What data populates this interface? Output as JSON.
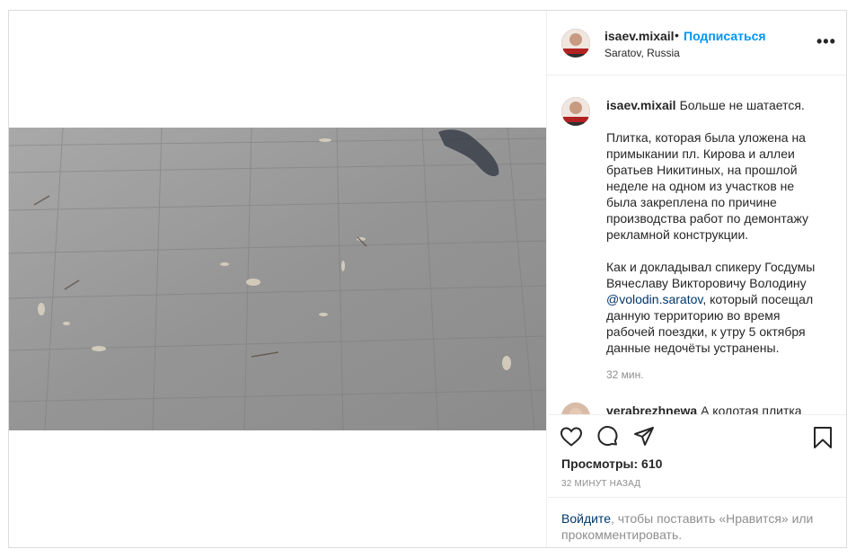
{
  "post": {
    "author": {
      "username": "isaev.mixail",
      "location": "Saratov, Russia",
      "follow_label": "Подписаться",
      "separator": "•",
      "more_label": "•••"
    },
    "caption": {
      "username": "isaev.mixail",
      "text_1": "Больше не шатается.\n\nПлитка, которая была уложена на примыкании пл. Кирова и аллеи братьев Никитиных, на прошлой неделе на одном из участков не была закреплена по причине производства работ по демонтажу рекламной конструкции.\n\nКак и докладывал спикеру Госдумы Вячеславу Викторовичу Володину ",
      "mention": "@volodin.saratov",
      "text_2": ", который посещал данную территорию во время рабочей поездки, к утру 5 октября данные недочёты устранены.",
      "time": "32 мин."
    },
    "next_comment": {
      "username": "verabrezhnewa",
      "text": "А колотая плитка"
    },
    "stats": {
      "views_label": "Просмотры: 610",
      "posted_ago": "32 МИНУТ НАЗАД"
    },
    "login_prompt": {
      "link": "Войдите",
      "text": ", чтобы поставить «Нравится» или прокомментировать."
    },
    "icons": {
      "like": "heart-icon",
      "comment": "comment-bubble-icon",
      "share": "paper-plane-icon",
      "save": "bookmark-icon"
    },
    "colors": {
      "accent": "#0095f6",
      "link": "#00376b",
      "muted": "#8e8e8e",
      "text": "#262626"
    }
  }
}
